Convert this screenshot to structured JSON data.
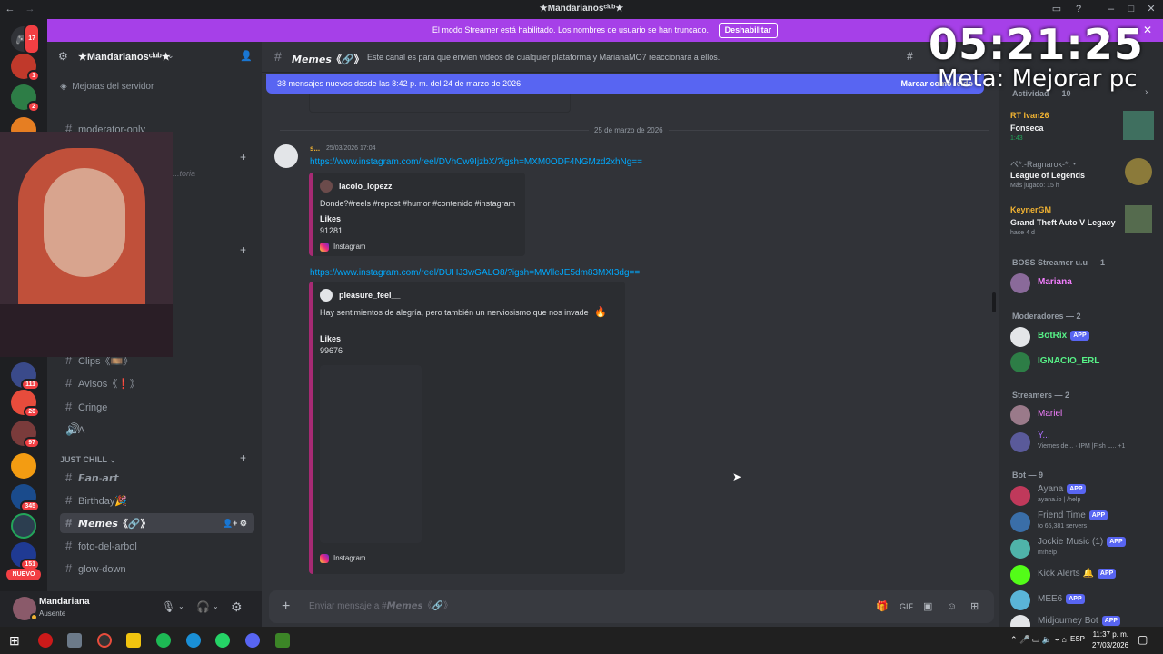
{
  "window": {
    "title": "★Mandarianosᶜˡᵘᵇ★"
  },
  "banner": {
    "text": "El modo Streamer está habilitado. Los nombres de usuario se han truncado.",
    "button": "Deshabilitar"
  },
  "server": {
    "name": "★Mandarianosᶜˡᵘᵇ★",
    "boost": "Mejoras del servidor"
  },
  "rail": {
    "badges": [
      "17",
      "1",
      "2",
      "111",
      "20",
      "97",
      "345",
      "151"
    ],
    "new_label": "NUEVO"
  },
  "sidebar": {
    "top_channel": "moderator-only",
    "top_channel_2": "...toria",
    "channels_a": [
      {
        "name": "Clips《🎞️》",
        "type": "text"
      },
      {
        "name": "Avisos《❗》",
        "type": "text"
      },
      {
        "name": "Cringe",
        "type": "text"
      },
      {
        "name": "A",
        "type": "voice"
      }
    ],
    "category": "JUST CHILL",
    "channels_b": [
      {
        "name": "𝙁𝙖𝙣-𝙖𝙧𝙩",
        "type": "text"
      },
      {
        "name": "Birthday🎉",
        "type": "text"
      },
      {
        "name": "𝙈𝙚𝙢𝙚𝙨《🔗》",
        "type": "text",
        "active": true
      },
      {
        "name": "foto-del-arbol",
        "type": "text"
      },
      {
        "name": "glow-down",
        "type": "text"
      }
    ]
  },
  "user": {
    "name": "Mandariana",
    "status": "Ausente"
  },
  "channel": {
    "name": "𝙈𝙚𝙢𝙚𝙨《🔗》",
    "topic": "Este canal es para que envien videos de cualquier plataforma y MarianaMO7 reaccionara a ellos.",
    "new_messages": "38 mensajes nuevos desde las 8:42 p. m. del 24 de marzo de 2026",
    "mark_read": "Marcar como leído",
    "date_divider": "25 de marzo de 2026",
    "message": {
      "author": "s...",
      "timestamp": "25/03/2026 17:04"
    },
    "link1": "https://www.instagram.com/reel/DVhCw9IjzbX/?igsh=MXM0ODF4NGMzd2xhNg==",
    "embed1": {
      "author": "lacolo_lopezz",
      "desc": "Donde?#reels #repost #humor #contenido #instagram",
      "field_name": "Likes",
      "field_value": "91281",
      "footer": "Instagram"
    },
    "link2": "https://www.instagram.com/reel/DUHJ3wGALO8/?igsh=MWlleJE5dm83MXI3dg==",
    "embed2": {
      "author": "pleasure_feel__",
      "desc": "Hay sentimientos de alegría, pero también un nerviosismo que nos invade",
      "emoji": "🔥",
      "field_name": "Likes",
      "field_value": "99676",
      "footer": "Instagram"
    },
    "composer_placeholder": "Enviar mensaje a #𝙈𝙚𝙢𝙚𝙨《🔗》"
  },
  "members": {
    "activity_label": "Actividad — 10",
    "activities": [
      {
        "user": "RT Ivan26",
        "title": "Fonseca",
        "sub": "1:43"
      },
      {
        "user": "ぺ*:-Ragnarok-*:・",
        "title": "League of Legends",
        "sub": "Más jugado: 15 h"
      },
      {
        "user": "KeynerGM",
        "title": "Grand Theft Auto V Legacy",
        "sub": "hace 4 d"
      }
    ],
    "boss_label": "BOSS Streamer u.u — 1",
    "boss": [
      {
        "name": "Mariana"
      }
    ],
    "mods_label": "Moderadores — 2",
    "mods": [
      {
        "name": "BotRix",
        "app": "APP"
      },
      {
        "name": "IGNACIO_ERL"
      }
    ],
    "streamers_label": "Streamers — 2",
    "streamers": [
      {
        "name": "Mariel"
      },
      {
        "name": "Y...",
        "sub": "Viernes de... · IPM |Fish L... +1"
      }
    ],
    "bots_label": "Bot — 9",
    "bots": [
      {
        "name": "Ayana",
        "sub": "ayana.io | /help",
        "app": "APP"
      },
      {
        "name": "Friend Time",
        "sub": "to 65,381 servers",
        "app": "APP"
      },
      {
        "name": "Jockie Music (1)",
        "sub": "m!help",
        "app": "APP"
      },
      {
        "name": "Kick Alerts 🔔",
        "app": "APP"
      },
      {
        "name": "MEE6",
        "app": "APP"
      },
      {
        "name": "Midjourney Bot",
        "app": "APP"
      }
    ]
  },
  "overlay": {
    "timer": "05:21:25",
    "goal": "Meta: Mejorar pc"
  },
  "taskbar": {
    "lang": "ESP",
    "time": "11:37 p. m.",
    "date": "27/03/2026"
  },
  "colors": {
    "banner": "#a640e8",
    "accent": "#5865f2",
    "link": "#00a8fc"
  }
}
